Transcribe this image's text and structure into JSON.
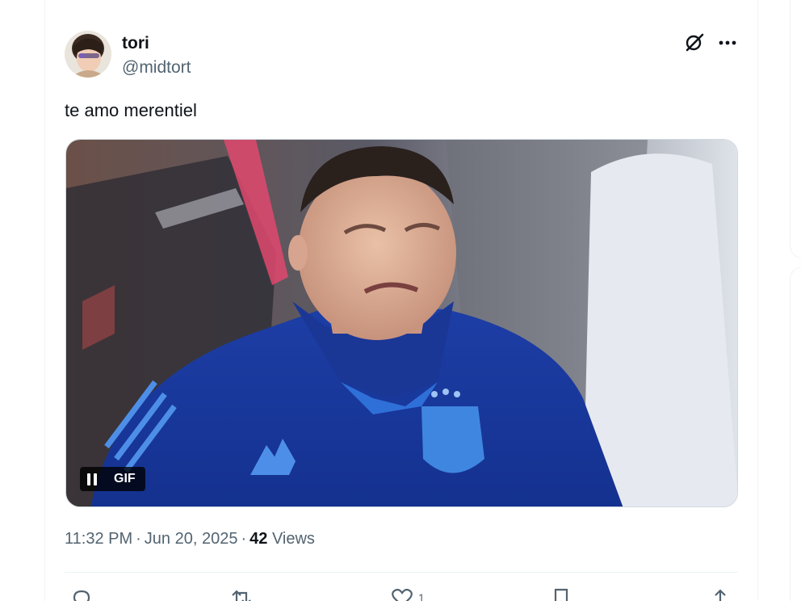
{
  "author": {
    "name": "tori",
    "handle": "@midtort",
    "avatar_icon": "profile-photo"
  },
  "header_icons": {
    "grok": "grok-icon",
    "more": "more-horizontal-icon"
  },
  "tweet": {
    "text": "te amo merentiel",
    "media": {
      "type": "gif",
      "badge": "GIF",
      "control": "pause-icon"
    }
  },
  "meta": {
    "time": "11:32 PM",
    "date": "Jun 20, 2025",
    "views_count": "42",
    "views_label": "Views"
  },
  "actions": {
    "reply": {
      "icon": "reply-icon",
      "count": ""
    },
    "repost": {
      "icon": "repost-icon",
      "count": ""
    },
    "like": {
      "icon": "like-icon",
      "count": "1"
    },
    "bookmark": {
      "icon": "bookmark-icon",
      "count": ""
    },
    "share": {
      "icon": "share-icon",
      "count": ""
    }
  },
  "colors": {
    "text_primary": "#0f1419",
    "text_secondary": "#536471",
    "border": "#eff3f4",
    "jersey_blue": "#1a3a9c"
  }
}
